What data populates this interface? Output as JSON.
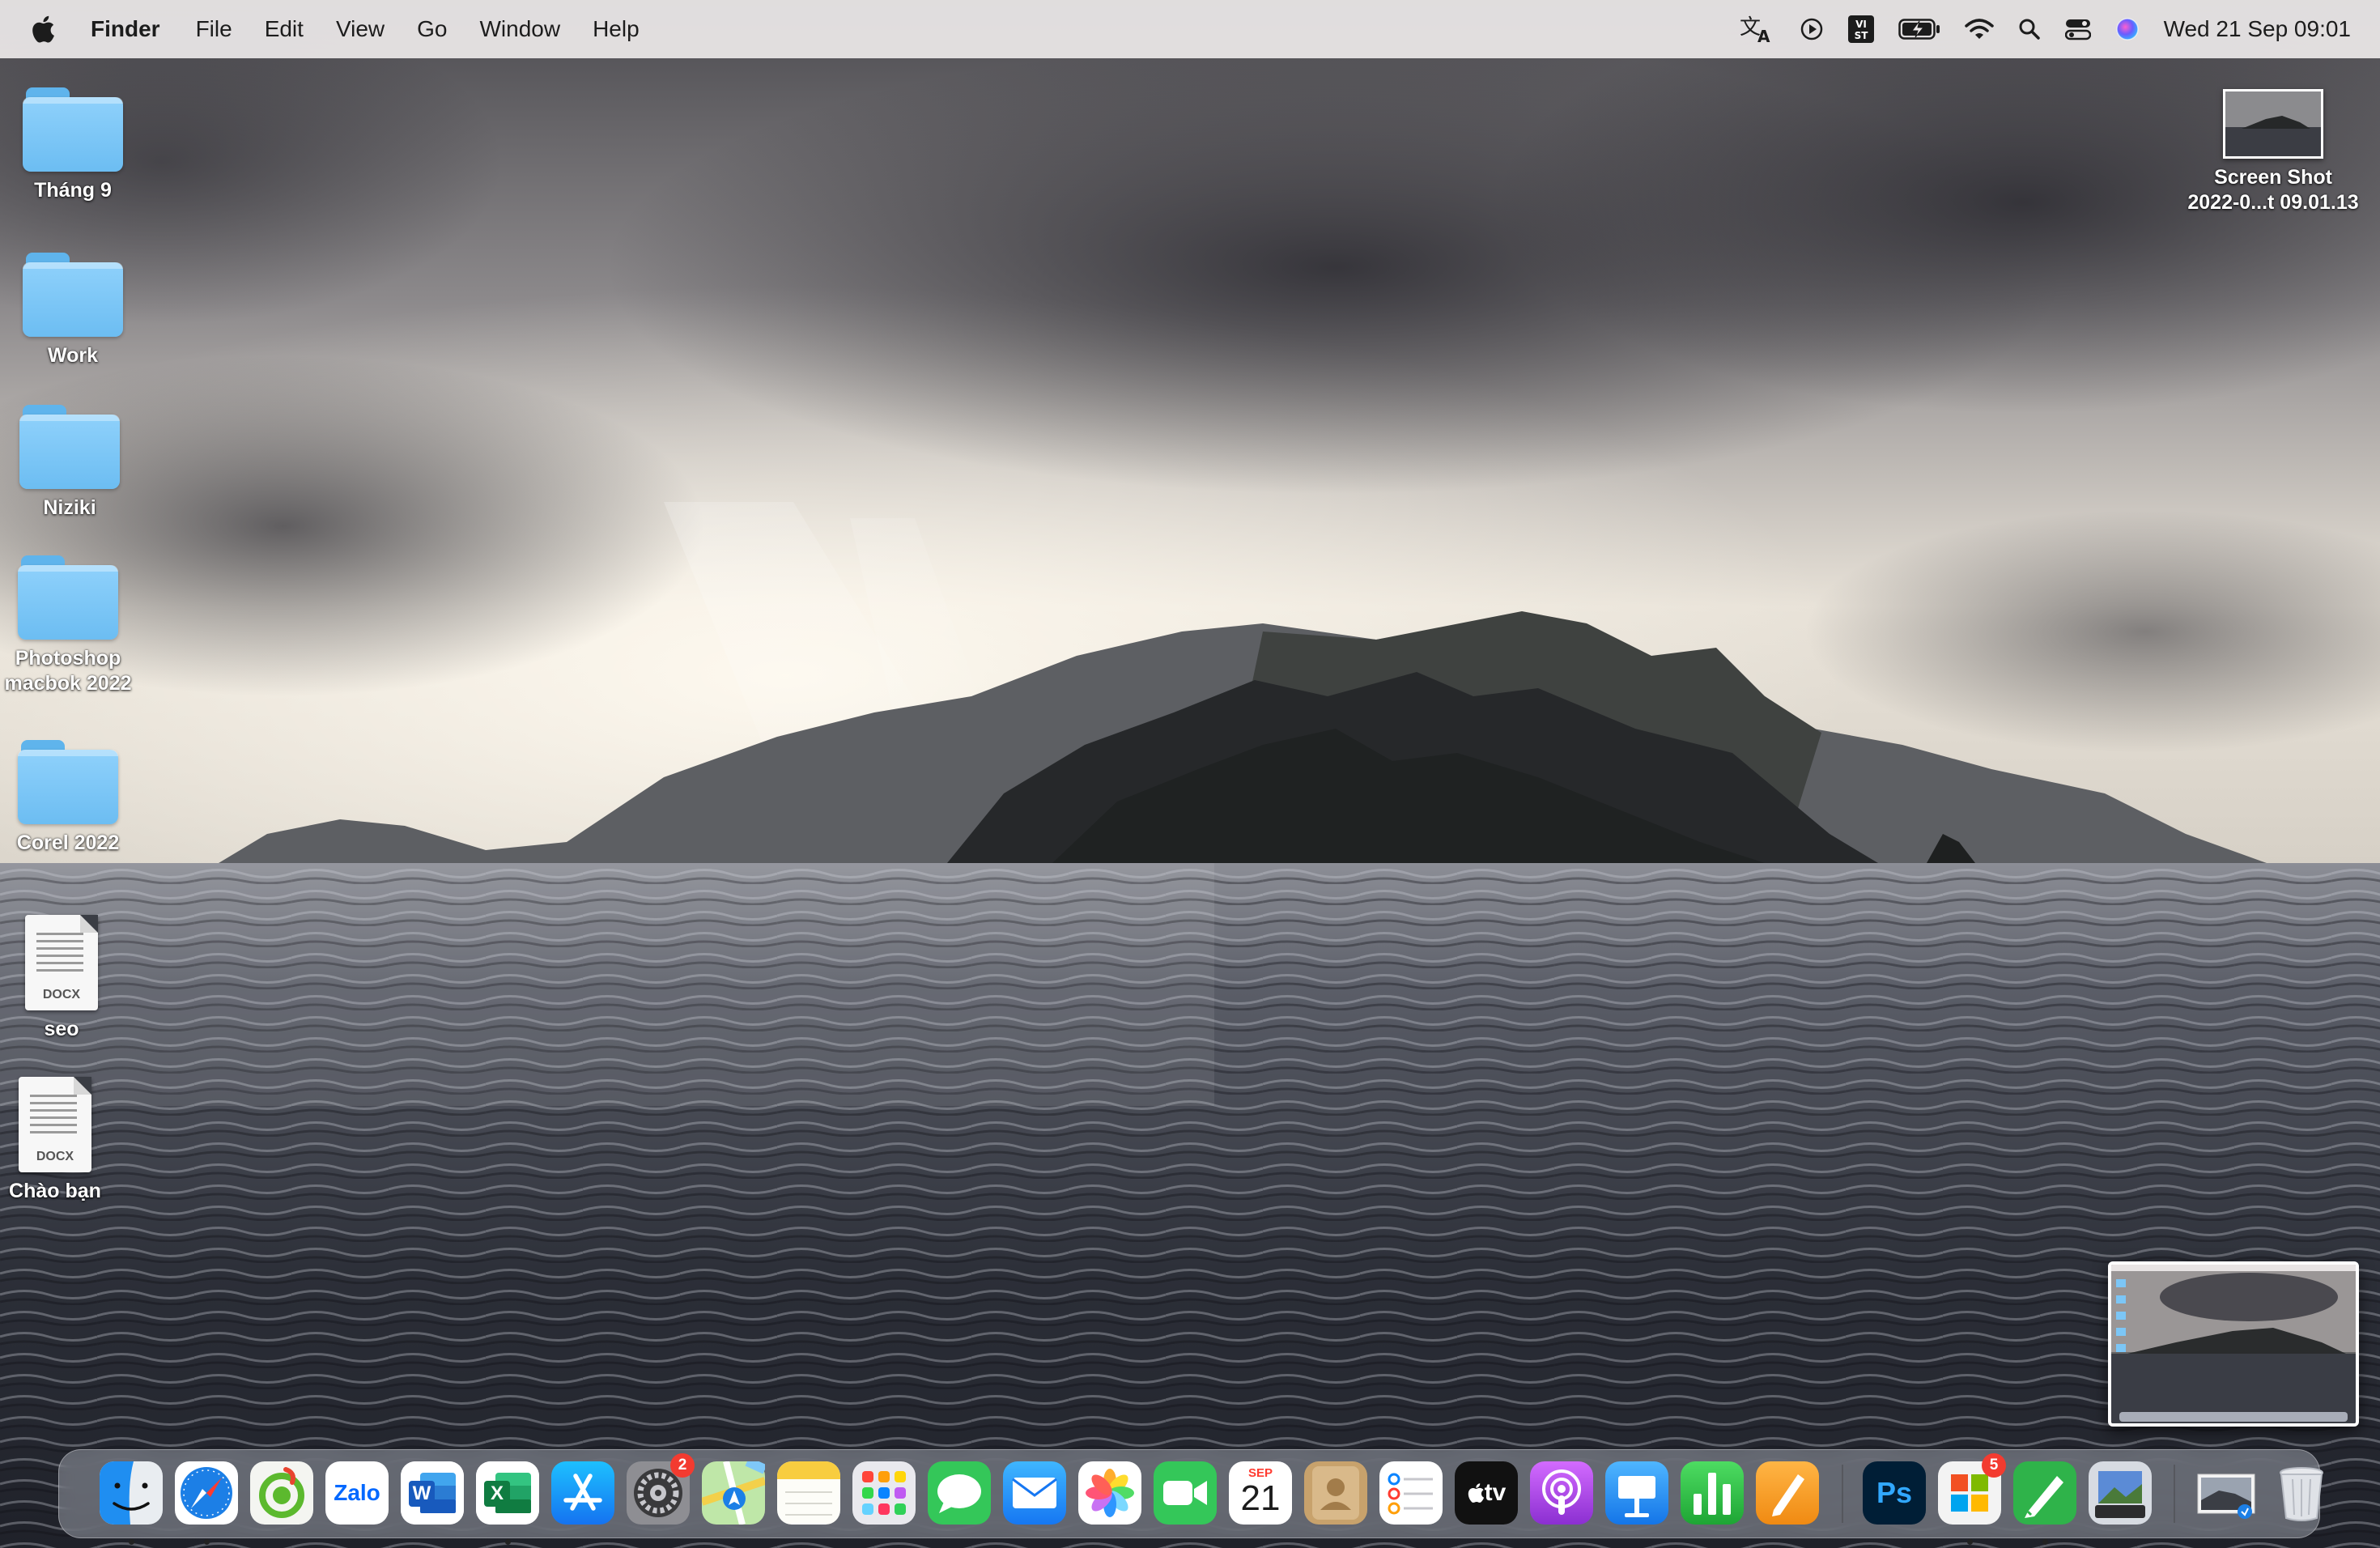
{
  "menubar": {
    "app_name": "Finder",
    "menus": [
      "File",
      "Edit",
      "View",
      "Go",
      "Window",
      "Help"
    ],
    "status_icons": [
      "translate-icon",
      "play-icon",
      "vietnamese-input-icon",
      "battery-charging-icon",
      "wifi-icon",
      "spotlight-search-icon",
      "control-center-icon",
      "siri-icon"
    ],
    "input_source_label": "VI ST",
    "clock": "Wed 21 Sep  09:01"
  },
  "desktop": {
    "items": [
      {
        "name": "Tháng 9",
        "kind": "folder"
      },
      {
        "name": "Work",
        "kind": "folder"
      },
      {
        "name": "Niziki",
        "kind": "folder"
      },
      {
        "name": "Photoshop macbok 2022",
        "line1": "Photoshop",
        "line2": "macbok 2022",
        "kind": "folder"
      },
      {
        "name": "Corel 2022",
        "kind": "folder"
      },
      {
        "name": "seo",
        "kind": "docx",
        "ext": "DOCX"
      },
      {
        "name": "Chào bạn",
        "kind": "docx",
        "ext": "DOCX"
      },
      {
        "name": "Screen Shot 2022-0...t 09.01.13",
        "line1": "Screen Shot",
        "line2": "2022-0...t 09.01.13",
        "kind": "screenshot"
      }
    ]
  },
  "dock": {
    "apps": [
      {
        "name": "Finder",
        "icon": "finder-icon",
        "running": true
      },
      {
        "name": "Safari",
        "icon": "safari-icon",
        "running": true
      },
      {
        "name": "CleanMyMac",
        "icon": "cleaner-icon",
        "running": false
      },
      {
        "name": "Zalo",
        "icon": "zalo-icon",
        "label": "Zalo",
        "running": false
      },
      {
        "name": "Microsoft Word",
        "icon": "word-icon",
        "label": "W",
        "running": false
      },
      {
        "name": "Microsoft Excel",
        "icon": "excel-icon",
        "label": "X",
        "running": true
      },
      {
        "name": "App Store",
        "icon": "app-store-icon",
        "running": false
      },
      {
        "name": "System Preferences",
        "icon": "system-preferences-icon",
        "badge": "2",
        "running": false
      },
      {
        "name": "Maps",
        "icon": "maps-icon",
        "running": false
      },
      {
        "name": "Notes",
        "icon": "notes-icon",
        "running": false
      },
      {
        "name": "Launchpad",
        "icon": "launchpad-icon",
        "running": false
      },
      {
        "name": "Messages",
        "icon": "messages-icon",
        "running": false
      },
      {
        "name": "Mail",
        "icon": "mail-icon",
        "running": false
      },
      {
        "name": "Photos",
        "icon": "photos-icon",
        "running": false
      },
      {
        "name": "FaceTime",
        "icon": "facetime-icon",
        "running": false
      },
      {
        "name": "Calendar",
        "icon": "calendar-icon",
        "month": "SEP",
        "day": "21",
        "running": false
      },
      {
        "name": "Contacts",
        "icon": "contacts-icon",
        "running": false
      },
      {
        "name": "Reminders",
        "icon": "reminders-icon",
        "running": false
      },
      {
        "name": "Apple TV",
        "icon": "apple-tv-icon",
        "label": "tv",
        "running": false
      },
      {
        "name": "Podcasts",
        "icon": "podcasts-icon",
        "running": false
      },
      {
        "name": "Keynote",
        "icon": "keynote-icon",
        "running": false
      },
      {
        "name": "Numbers",
        "icon": "numbers-icon",
        "running": false
      },
      {
        "name": "Pages",
        "icon": "pages-icon",
        "running": false
      },
      {
        "name": "Photoshop",
        "icon": "photoshop-icon",
        "label": "Ps",
        "running": false
      },
      {
        "name": "Microsoft Office",
        "icon": "microsoft-office-icon",
        "badge": "5",
        "running": true
      },
      {
        "name": "Evernote Pen",
        "icon": "green-pen-icon",
        "running": true
      },
      {
        "name": "Preview",
        "icon": "preview-icon",
        "running": false
      },
      {
        "name": "Downloads Stack",
        "icon": "downloads-stack-icon",
        "running": false
      },
      {
        "name": "Trash",
        "icon": "trash-icon",
        "running": false
      }
    ]
  },
  "screenshot_preview": {
    "label": "screenshot-preview-thumbnail"
  },
  "colors": {
    "menubar_bg": "#ece8e8",
    "folder_blue": "#7cc6f6",
    "badge_red": "#f33b30"
  }
}
